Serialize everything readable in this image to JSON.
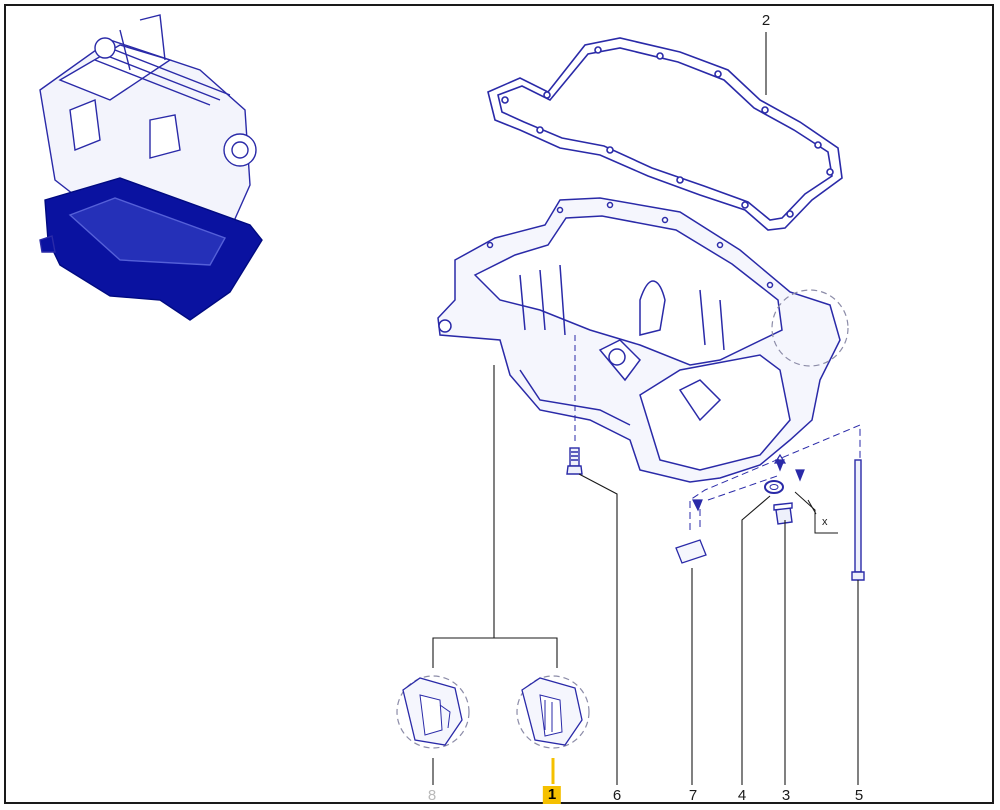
{
  "callouts": {
    "c1": "1",
    "c2": "2",
    "c3": "3",
    "c4": "4",
    "c5": "5",
    "c6": "6",
    "c7": "7",
    "c8": "8"
  },
  "dimension_label": "x",
  "colors": {
    "part_line": "#2a2aa8",
    "part_fill": "#eef0fb",
    "highlight_fill": "#0a12a0",
    "leader": "#1a1a1a",
    "detail_circle": "#8c8ca8",
    "selected_callout": "#f5c000",
    "inactive_callout": "#b9b9b9"
  },
  "icons": [
    "engine-illustration",
    "oil-pan",
    "gasket",
    "drain-plug",
    "washer",
    "bolt",
    "screw",
    "label-tag"
  ]
}
